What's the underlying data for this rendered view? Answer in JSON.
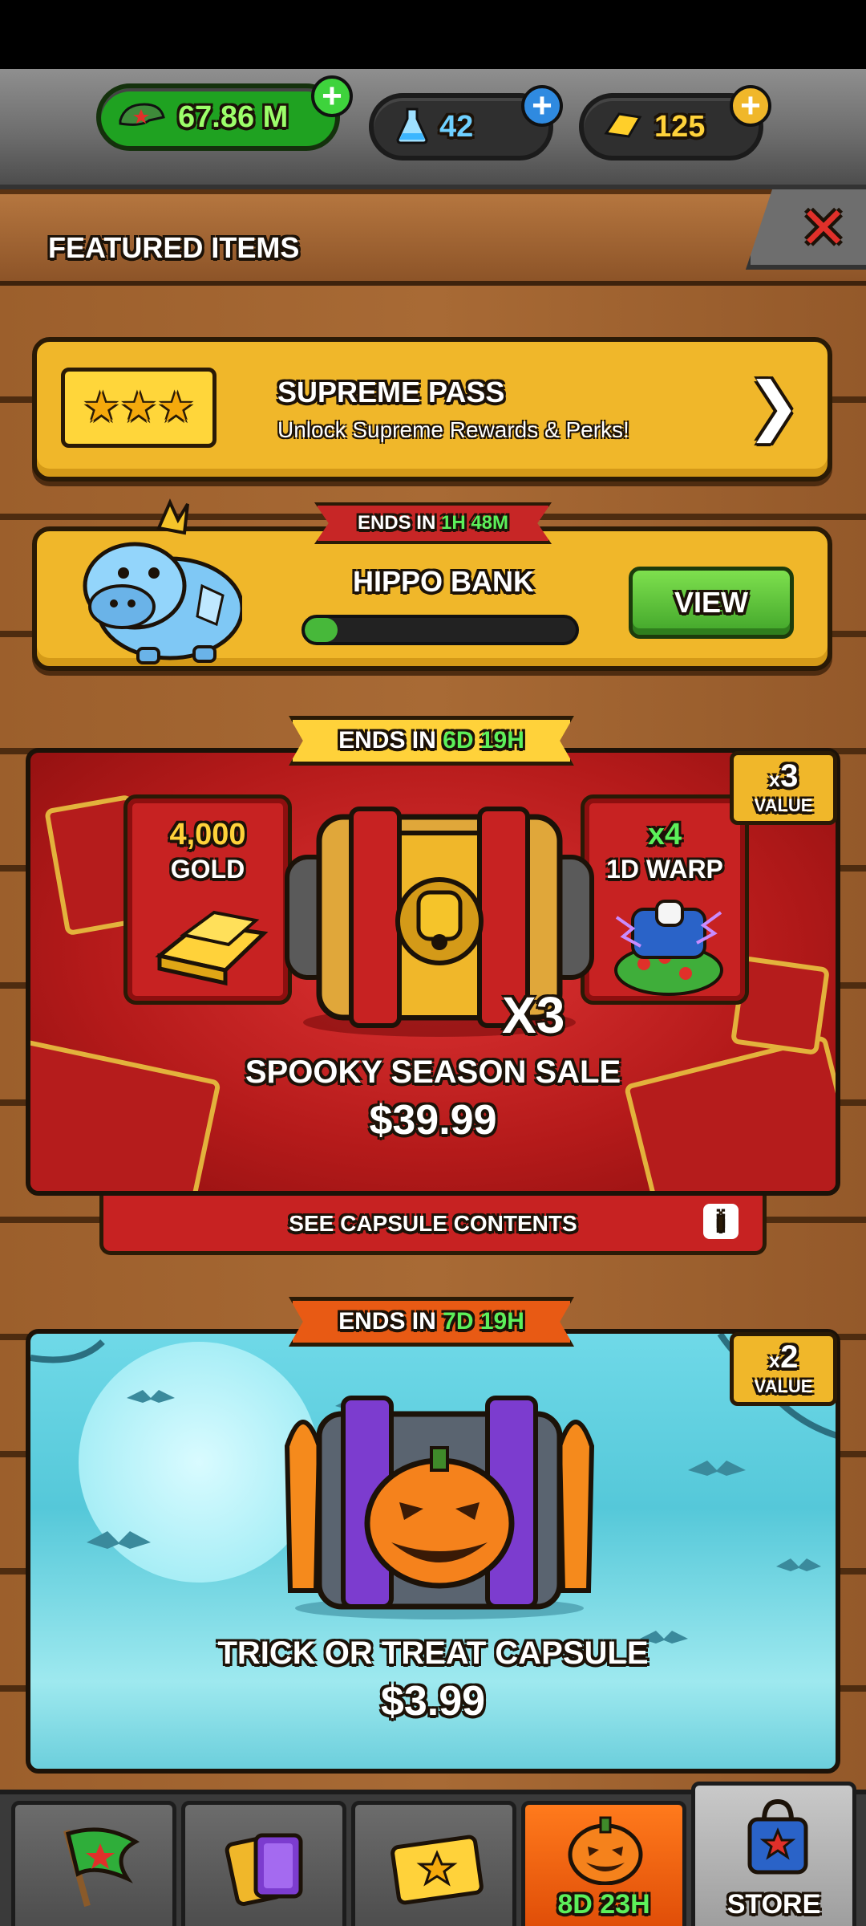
{
  "currency": {
    "cash": "67.86 M",
    "flask": "42",
    "gold": "125"
  },
  "header": {
    "title": "FEATURED ITEMS"
  },
  "supreme_pass": {
    "title": "SUPREME PASS",
    "subtitle": "Unlock Supreme Rewards & Perks!"
  },
  "hippo_bank": {
    "ends_label": "ENDS IN",
    "ends_time": "1H 48M",
    "title": "HIPPO BANK",
    "progress": 0.12,
    "view_label": "VIEW"
  },
  "spooky_sale": {
    "ends_label": "ENDS IN",
    "ends_time": "6D 19H",
    "value_mult": "3",
    "value_prefix": "x",
    "value_label": "VALUE",
    "gold_amount": "4,000",
    "gold_label": "GOLD",
    "warp_count": "x4",
    "warp_label": "1D WARP",
    "capsule_mult": "X3",
    "name": "SPOOKY SEASON SALE",
    "price": "$39.99",
    "see_contents": "SEE CAPSULE CONTENTS"
  },
  "trick_treat": {
    "ends_label": "ENDS IN",
    "ends_time": "7D 19H",
    "value_mult": "2",
    "value_prefix": "x",
    "value_label": "VALUE",
    "name": "TRICK OR TREAT CAPSULE",
    "price": "$3.99"
  },
  "bottom_nav": {
    "event_timer": "8D 23H",
    "store_label": "STORE"
  },
  "colors": {
    "accent_yellow": "#f0b72a",
    "sale_red": "#c72222",
    "green_button": "#41a52a",
    "timer_green": "#5cf05a"
  }
}
